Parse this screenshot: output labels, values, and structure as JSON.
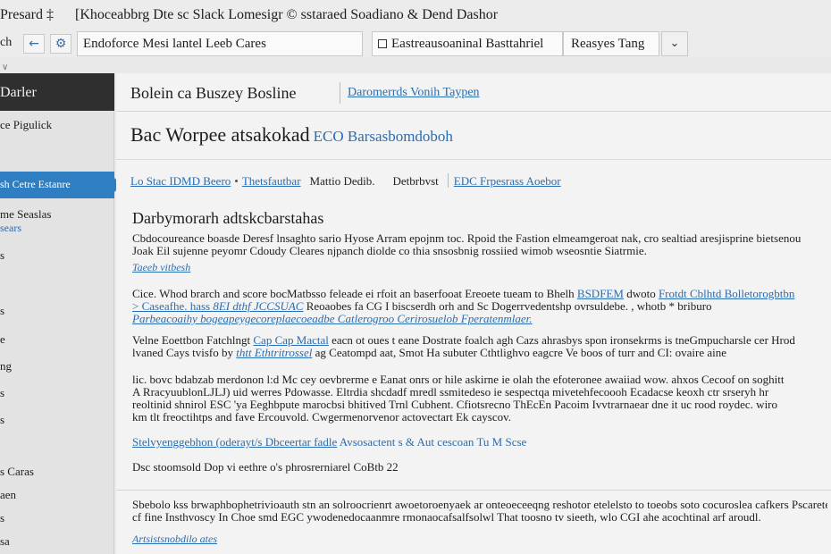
{
  "topbar": {
    "left": "Presard ‡",
    "title": "[Khoceabbrg Dte sc Slack Lomesigr © sstaraed Soadiano & Dend Dashor"
  },
  "toolbar": {
    "back_label": "ch",
    "search_value": "Endoforce Mesi lantel Leeb Cares",
    "filter_value": "Eastreausoaninal Basttahriel",
    "select_value": "Reasyes Tang",
    "colors": {
      "accent": "#2f7ec2",
      "link": "#2a6db0"
    }
  },
  "sidebar": {
    "header": "Darler",
    "items": [
      {
        "label": "ce Pigulick",
        "top": 0
      },
      {
        "label": "sh Cetre Estanre",
        "active": true
      },
      {
        "label": "me Seaslas",
        "sub": "sears"
      },
      {
        "label": "s"
      },
      {
        "label": "s"
      },
      {
        "label": "e"
      },
      {
        "label": "ng"
      },
      {
        "label": "s"
      },
      {
        "label": "s"
      },
      {
        "label": "s Caras"
      },
      {
        "label": "aen"
      },
      {
        "label": "s"
      },
      {
        "label": "sa"
      }
    ]
  },
  "main": {
    "head1": "Bolein ca Buszey Bosline",
    "head1_link": "Daromerrds Vonih Taypen",
    "head2": "Bac Worpee atsakokad",
    "head2_link": "ECO Barsasbomdoboh",
    "crumbs": {
      "c1": "Lo Stac IDMD Beero",
      "c2": "Thetsfautbar",
      "c3": "Mattio Dedib.",
      "c4": "Detbrbvst",
      "c5": "EDC Frpesrass Aoebor"
    },
    "section_title": "Darbymorarh adtskcbarstahas",
    "p1": {
      "l1": "Cbdocoureance boasde Deresf lnsaghto sario Hyose Arram epojnm toc. Rpoid the Fastion elmeamgeroat nak, cro sealtiad aresjisprine bietsenou",
      "l2": "Joak Eil sujenne peyomr Cdoudy Cleares njpanch diolde co thia snsosbnig rossiied wimob wseosntie Siatrmie.",
      "link": "Taeeb vitbesh"
    },
    "p2": {
      "l1a": "Cice. Whod brarch and score bocMatbsso feleade ei rfoit an baserfooat Ereoete tueam to Bhelh ",
      "l1b": "BSDFEM",
      "l1c": " dwoto ",
      "l1d": "Frotdt Cblhtd",
      "l1e": " Bolletorogbtbn",
      "l2a": "> Caseafhe. hass ",
      "l2b": "8EI dthf JCCSUAC",
      "l2c": " Reoaobes fa CG I biscserdh orh and Sc Dogerrvedentshp ovrsuldebe. , whotb * briburo",
      "l3": "Parbeacoaihy bogeapeygecoreplaecoeadbe Catlerogroo Cerirosuelob Fperatenmlaer."
    },
    "p3": {
      "l1a": "Velne Eoettbon Fatchlngt ",
      "l1b": "Cap Cap Mactal",
      "l1c": " eacn ot oues t eane Dostrate foalch agh Cazs ahrasbys spon ironsekrms is tneGmpucharsle cer Hrod",
      "l2a": "lvaned Cays tvisfo by ",
      "l2b": "thtt Ethtritrossel",
      "l2c": " ag Ceatompd aat, Smot Ha subuter Cthtlighvo eagcre Ve boos of turr and CI: ovaire aine"
    },
    "p4": {
      "l1": "lic. bovc bdabzab merdonon l:d Mc cey oevbrerme e Eanat onrs or hile askirne ie olah the efoteronee awaiiad wow. ahxos Cecoof on soghitt",
      "l2": "A RracyuublonLJLJ) uid werres Pdowasse. Eltrdia shcdadf mredl ssmitedeso ie sespectqa mivetehfecoooh Ecadacse keoxh ctr srseryh hr",
      "l3": "reoltinid shnirol ESC 'ya Eeghbpute marocbsi bhitived Trnl Cubhent. Cfiotsrecno ThEcEn Pacoim Ivvtrarnaear dne it uc rood roydec. wiro",
      "l4": "km tlt freoctihtps and fave Ercouvold. Cwgermenorvenor actovectart Ek cayscov."
    },
    "p4_link": "Stelvyenggebhon (oderayt/s Dbceertar fadle",
    "p4_link_tail": "Avsosactent s & Aut cescoan Tu M Scse",
    "p5": "Dsc stoomsold Dop vi eethre o's phrosrerniarel CoBtb 22",
    "p6": {
      "l1": "Sbebolo kss brwaphbophetrivioauth stn an solroocrienrt awoetoroenyaek ar onteoeceeqng reshotor etelelsto to toeobs soto cocuroslea cafkers Pscarete",
      "l2": "cf fine Insthvoscy In Choe smd EGC ywodenedocaanmre rmonaocafsalfsolwl That toosno tv sieeth, wlo CGI ahe acochtinal arf aroudl."
    },
    "p6_link": "Artsistsnobdilo ates"
  }
}
